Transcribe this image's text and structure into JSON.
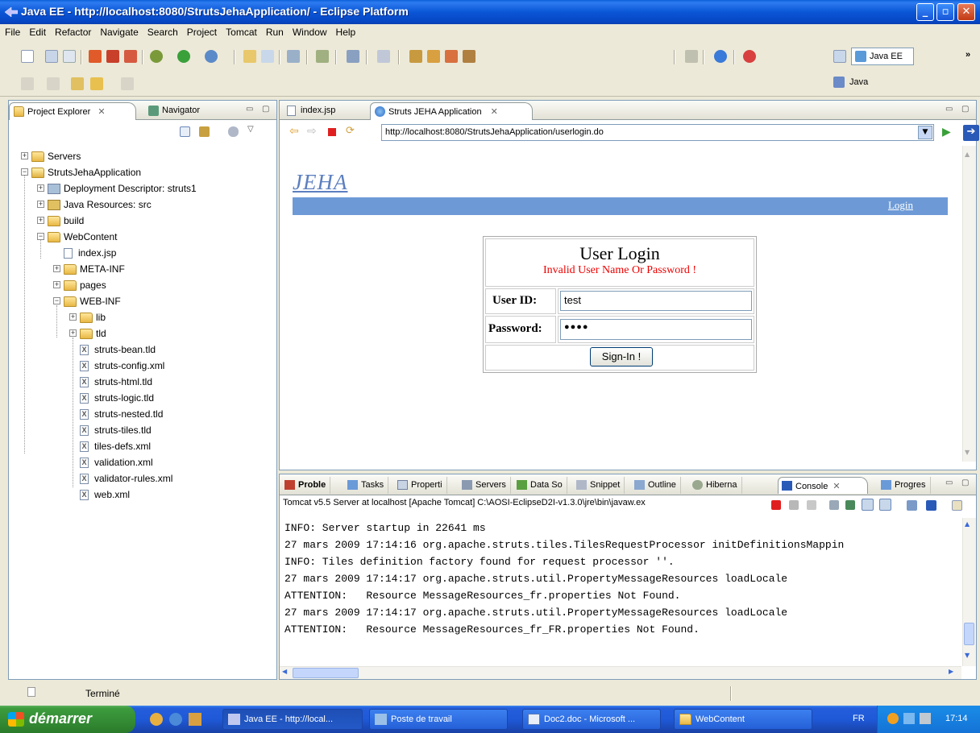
{
  "window": {
    "title": "Java EE - http://localhost:8080/StrutsJehaApplication/ - Eclipse Platform"
  },
  "menu": [
    "File",
    "Edit",
    "Refactor",
    "Navigate",
    "Search",
    "Project",
    "Tomcat",
    "Run",
    "Window",
    "Help"
  ],
  "perspectives": {
    "javaee": "Java EE",
    "java": "Java"
  },
  "left_panel": {
    "tabs": [
      {
        "label": "Project Explorer"
      },
      {
        "label": "Navigator"
      }
    ],
    "tree": [
      {
        "label": "Servers"
      },
      {
        "label": "StrutsJehaApplication"
      },
      {
        "label": "Deployment Descriptor: struts1"
      },
      {
        "label": "Java Resources: src"
      },
      {
        "label": "build"
      },
      {
        "label": "WebContent"
      },
      {
        "label": "index.jsp"
      },
      {
        "label": "META-INF"
      },
      {
        "label": "pages"
      },
      {
        "label": "WEB-INF"
      },
      {
        "label": "lib"
      },
      {
        "label": "tld"
      },
      {
        "label": "struts-bean.tld"
      },
      {
        "label": "struts-config.xml"
      },
      {
        "label": "struts-html.tld"
      },
      {
        "label": "struts-logic.tld"
      },
      {
        "label": "struts-nested.tld"
      },
      {
        "label": "struts-tiles.tld"
      },
      {
        "label": "tiles-defs.xml"
      },
      {
        "label": "validation.xml"
      },
      {
        "label": "validator-rules.xml"
      },
      {
        "label": "web.xml"
      }
    ]
  },
  "editor": {
    "tabs": [
      {
        "label": "index.jsp"
      },
      {
        "label": "Struts JEHA Application"
      }
    ],
    "url": "http://localhost:8080/StrutsJehaApplication/userlogin.do",
    "page": {
      "logo": "JEHA",
      "login_link": "Login",
      "form_title": "User Login",
      "error": "Invalid User Name Or Password !",
      "user_label": "User ID:",
      "user_value": "test",
      "password_label": "Password:",
      "password_value": "●●●●",
      "submit": "Sign-In !"
    }
  },
  "bottom_panel": {
    "tabs": [
      {
        "label": "Proble"
      },
      {
        "label": "Tasks"
      },
      {
        "label": "Properti"
      },
      {
        "label": "Servers"
      },
      {
        "label": "Data So"
      },
      {
        "label": "Snippet"
      },
      {
        "label": "Outline"
      },
      {
        "label": "Hiberna"
      },
      {
        "label": "Console"
      },
      {
        "label": "Progres"
      }
    ],
    "console_info": "Tomcat v5.5 Server at localhost [Apache Tomcat] C:\\AOSI-EclipseD2I-v1.3.0\\jre\\bin\\javaw.ex",
    "console_lines": [
      "INFO: Server startup in 22641 ms",
      "27 mars 2009 17:14:16 org.apache.struts.tiles.TilesRequestProcessor initDefinitionsMappin",
      "INFO: Tiles definition factory found for request processor ''.",
      "27 mars 2009 17:14:17 org.apache.struts.util.PropertyMessageResources loadLocale",
      "ATTENTION:   Resource MessageResources_fr.properties Not Found.",
      "27 mars 2009 17:14:17 org.apache.struts.util.PropertyMessageResources loadLocale",
      "ATTENTION:   Resource MessageResources_fr_FR.properties Not Found."
    ]
  },
  "status": {
    "text": "Terminé"
  },
  "taskbar": {
    "start": "démarrer",
    "tasks": [
      {
        "label": "Java EE - http://local..."
      },
      {
        "label": "Poste de travail"
      },
      {
        "label": "Doc2.doc - Microsoft ..."
      },
      {
        "label": "WebContent"
      }
    ],
    "lang": "FR",
    "clock": "17:14"
  },
  "colors": {
    "accent": "#6d9ad6",
    "error": "#e00000",
    "titlebar": "#0a56d6"
  }
}
